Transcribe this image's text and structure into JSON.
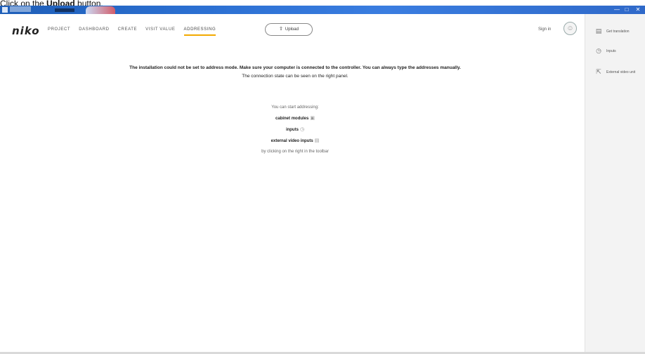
{
  "instruction": {
    "prefix": "Click on the ",
    "emphasis": "Upload",
    "suffix": " button."
  },
  "window": {
    "minimize": "—",
    "maximize": "□",
    "close": "✕"
  },
  "header": {
    "logo": "niko",
    "nav": [
      {
        "label": "PROJECT",
        "active": false
      },
      {
        "label": "DASHBOARD",
        "active": false
      },
      {
        "label": "CREATE",
        "active": false
      },
      {
        "label": "VISIT VALUE",
        "active": false
      },
      {
        "label": "ADDRESSING",
        "active": true
      }
    ],
    "upload_label": "Upload",
    "upload_icon": "upload-arrow-icon",
    "signin_label": "Sign in"
  },
  "main": {
    "warning_line1": "The installation could not be set to address mode. Make sure your computer is connected to the controller. You can always type the addresses manually.",
    "warning_line2": "The connection state can be seen on the right panel.",
    "intro": "You can start addressing:",
    "items": [
      {
        "label": "cabinet modules",
        "icon": "module-icon"
      },
      {
        "label": "inputs",
        "icon": "input-icon"
      },
      {
        "label": "external video inputs",
        "icon": "video-icon"
      }
    ],
    "hint": "by clicking on the right in the toolbar"
  },
  "sidebar": {
    "items": [
      {
        "label": "Get translation",
        "icon": "document-icon"
      },
      {
        "label": "Inputs",
        "icon": "clock-icon"
      },
      {
        "label": "External video unit",
        "icon": "export-icon"
      }
    ]
  },
  "colors": {
    "accent": "#f2a900",
    "titlebar": "#2b6fd1",
    "sidebar_bg": "#f3f3f3"
  }
}
